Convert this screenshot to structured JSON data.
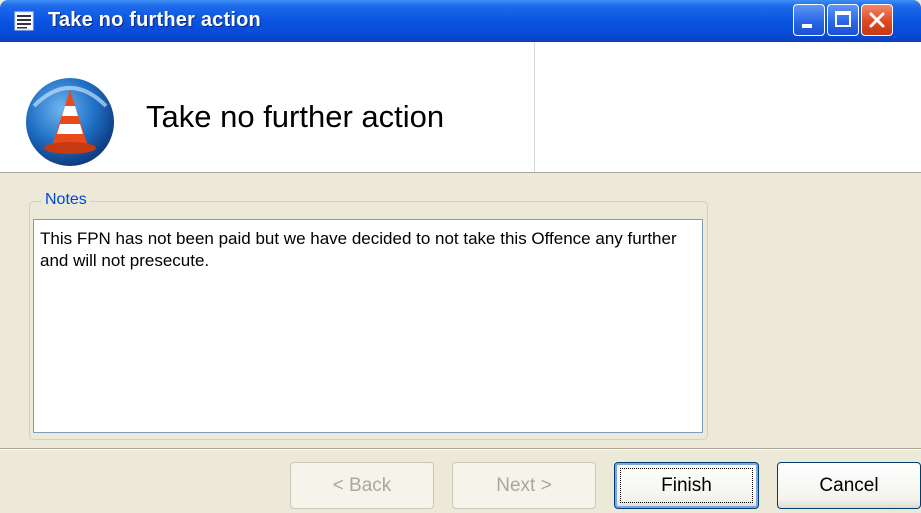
{
  "window": {
    "title": "Take no further action",
    "controls": [
      "minimize",
      "maximize",
      "close"
    ]
  },
  "header": {
    "title": "Take no further action",
    "icon": "traffic-cone-icon"
  },
  "notes": {
    "legend": "Notes",
    "text": "This FPN has not been paid but we have decided to not take this Offence any further and will not presecute."
  },
  "buttons": {
    "back": "< Back",
    "next": "Next >",
    "finish": "Finish",
    "cancel": "Cancel"
  },
  "colors": {
    "titlebar": "#0a54e3",
    "legend": "#0046d5",
    "dialog_bg": "#ece9d8"
  }
}
